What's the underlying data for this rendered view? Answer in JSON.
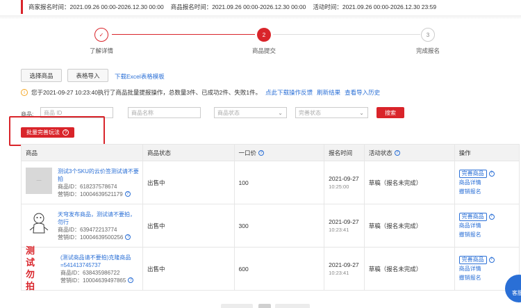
{
  "header": {
    "merchant_time": "商家报名时间：2021.09.26 00:00-2026.12.30 00:00",
    "product_time": "商品报名时间：2021.09.26 00:00-2026.12.30 00:00",
    "activity_time": "活动时间：2021.09.26 00:00-2026.12.30 23:59"
  },
  "steps": [
    {
      "num": "✓",
      "label": "了解详情",
      "state": "done"
    },
    {
      "num": "2",
      "label": "商品提交",
      "state": "active"
    },
    {
      "num": "3",
      "label": "完成报名",
      "state": "todo"
    }
  ],
  "toolbar": {
    "select_products": "选择商品",
    "table_import": "表格导入",
    "download_template": "下载Excel表格模板"
  },
  "notice": {
    "text": "您于2021-09-27 10:23:40执行了商品批量提报操作，总数量3件、已成功2件、失败1件。",
    "download_feedback": "点此下载操作反馈",
    "refresh": "刷新结果",
    "history": "查看导入历史"
  },
  "filters": {
    "label": "商品:",
    "product_id_placeholder": "商品 ID",
    "product_name_placeholder": "商品名称",
    "product_status": "商品状态",
    "perfect_status": "完善状态",
    "search": "搜索"
  },
  "batch_button": "批量完善玩法",
  "table": {
    "headers": {
      "product": "商品",
      "status": "商品状态",
      "price": "一口价",
      "time": "报名时间",
      "activity_status": "活动状态",
      "ops": "操作"
    },
    "rows": [
      {
        "title": "测试3个SKU的云价签测试请不要拍",
        "product_id": "商品ID：618237578674",
        "marketing_id": "营销ID：10004639521179",
        "status": "出售中",
        "price": "100",
        "date": "2021-09-27",
        "time": "10:25:00",
        "activity_status": "草稿（报名未完成）",
        "op_perfect": "完善商品",
        "op_detail": "商品详情",
        "op_withdraw": "撤销报名"
      },
      {
        "title": "天穹发布商品，测试请不要拍，勿行",
        "product_id": "商品ID：639472213774",
        "marketing_id": "营销ID：10004639500256",
        "status": "出售中",
        "price": "300",
        "date": "2021-09-27",
        "time": "10:23:41",
        "activity_status": "草稿（报名未完成）",
        "op_perfect": "完善商品",
        "op_detail": "商品详情",
        "op_withdraw": "撤销报名"
      },
      {
        "title": "(测试商品请不要拍)克隆商品=541413745737",
        "product_id": "商品ID：638435986722",
        "marketing_id": "营销ID：10004639497865",
        "status": "出售中",
        "price": "600",
        "date": "2021-09-27",
        "time": "10:23:41",
        "activity_status": "草稿（报名未完成）",
        "op_perfect": "完善商品",
        "op_detail": "商品详情",
        "op_withdraw": "撤销报名"
      }
    ],
    "thumb_test_chars": [
      "测 试",
      "勿 拍"
    ]
  },
  "float_service": "客服",
  "colors": {
    "accent": "#d9242a",
    "link": "#2a6fd6"
  }
}
